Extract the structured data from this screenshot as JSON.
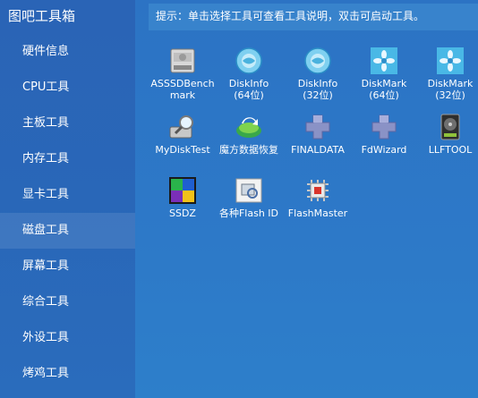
{
  "app": {
    "title": "图吧工具箱"
  },
  "sidebar": {
    "items": [
      {
        "label": "硬件信息"
      },
      {
        "label": "CPU工具"
      },
      {
        "label": "主板工具"
      },
      {
        "label": "内存工具"
      },
      {
        "label": "显卡工具"
      },
      {
        "label": "磁盘工具",
        "active": true
      },
      {
        "label": "屏幕工具"
      },
      {
        "label": "综合工具"
      },
      {
        "label": "外设工具"
      },
      {
        "label": "烤鸡工具"
      }
    ]
  },
  "hint": {
    "text": "提示：单击选择工具可查看工具说明，双击可启动工具。"
  },
  "tools": [
    {
      "line1": "ASSSDBench",
      "line2": "mark",
      "icon": "ssd-icon"
    },
    {
      "line1": "DiskInfo",
      "line2": "(64位)",
      "icon": "diskinfo-icon"
    },
    {
      "line1": "DiskInfo",
      "line2": "(32位)",
      "icon": "diskinfo-icon"
    },
    {
      "line1": "DiskMark",
      "line2": "(64位)",
      "icon": "flower-icon"
    },
    {
      "line1": "DiskMark",
      "line2": "(32位)",
      "icon": "flower-icon"
    },
    {
      "line1": "MyDiskTest",
      "line2": "",
      "icon": "magnifier-disk-icon"
    },
    {
      "line1": "魔方数据恢复",
      "line2": "",
      "icon": "recovery-icon"
    },
    {
      "line1": "FINALDATA",
      "line2": "",
      "icon": "puzzle-icon"
    },
    {
      "line1": "FdWizard",
      "line2": "",
      "icon": "puzzle-icon"
    },
    {
      "line1": "LLFTOOL",
      "line2": "",
      "icon": "hdd-icon"
    },
    {
      "line1": "SSDZ",
      "line2": "",
      "icon": "ssdz-icon"
    },
    {
      "line1": "各种Flash ID",
      "line2": "",
      "icon": "flashid-icon"
    },
    {
      "line1": "FlashMaster",
      "line2": "",
      "icon": "chip-icon"
    }
  ]
}
